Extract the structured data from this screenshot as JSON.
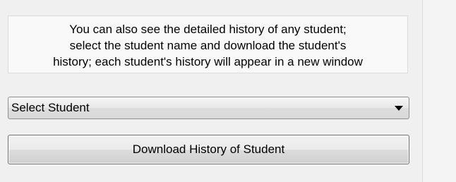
{
  "info": {
    "lines": [
      "You can also see the detailed history of any student;",
      "select the student name and download the student's",
      "history; each student's history will appear in a new window"
    ]
  },
  "student_select": {
    "selected_value": "Select Student"
  },
  "download_button": {
    "label": "Download History of Student"
  },
  "icons": {
    "dropdown": "chevron-down-icon"
  }
}
